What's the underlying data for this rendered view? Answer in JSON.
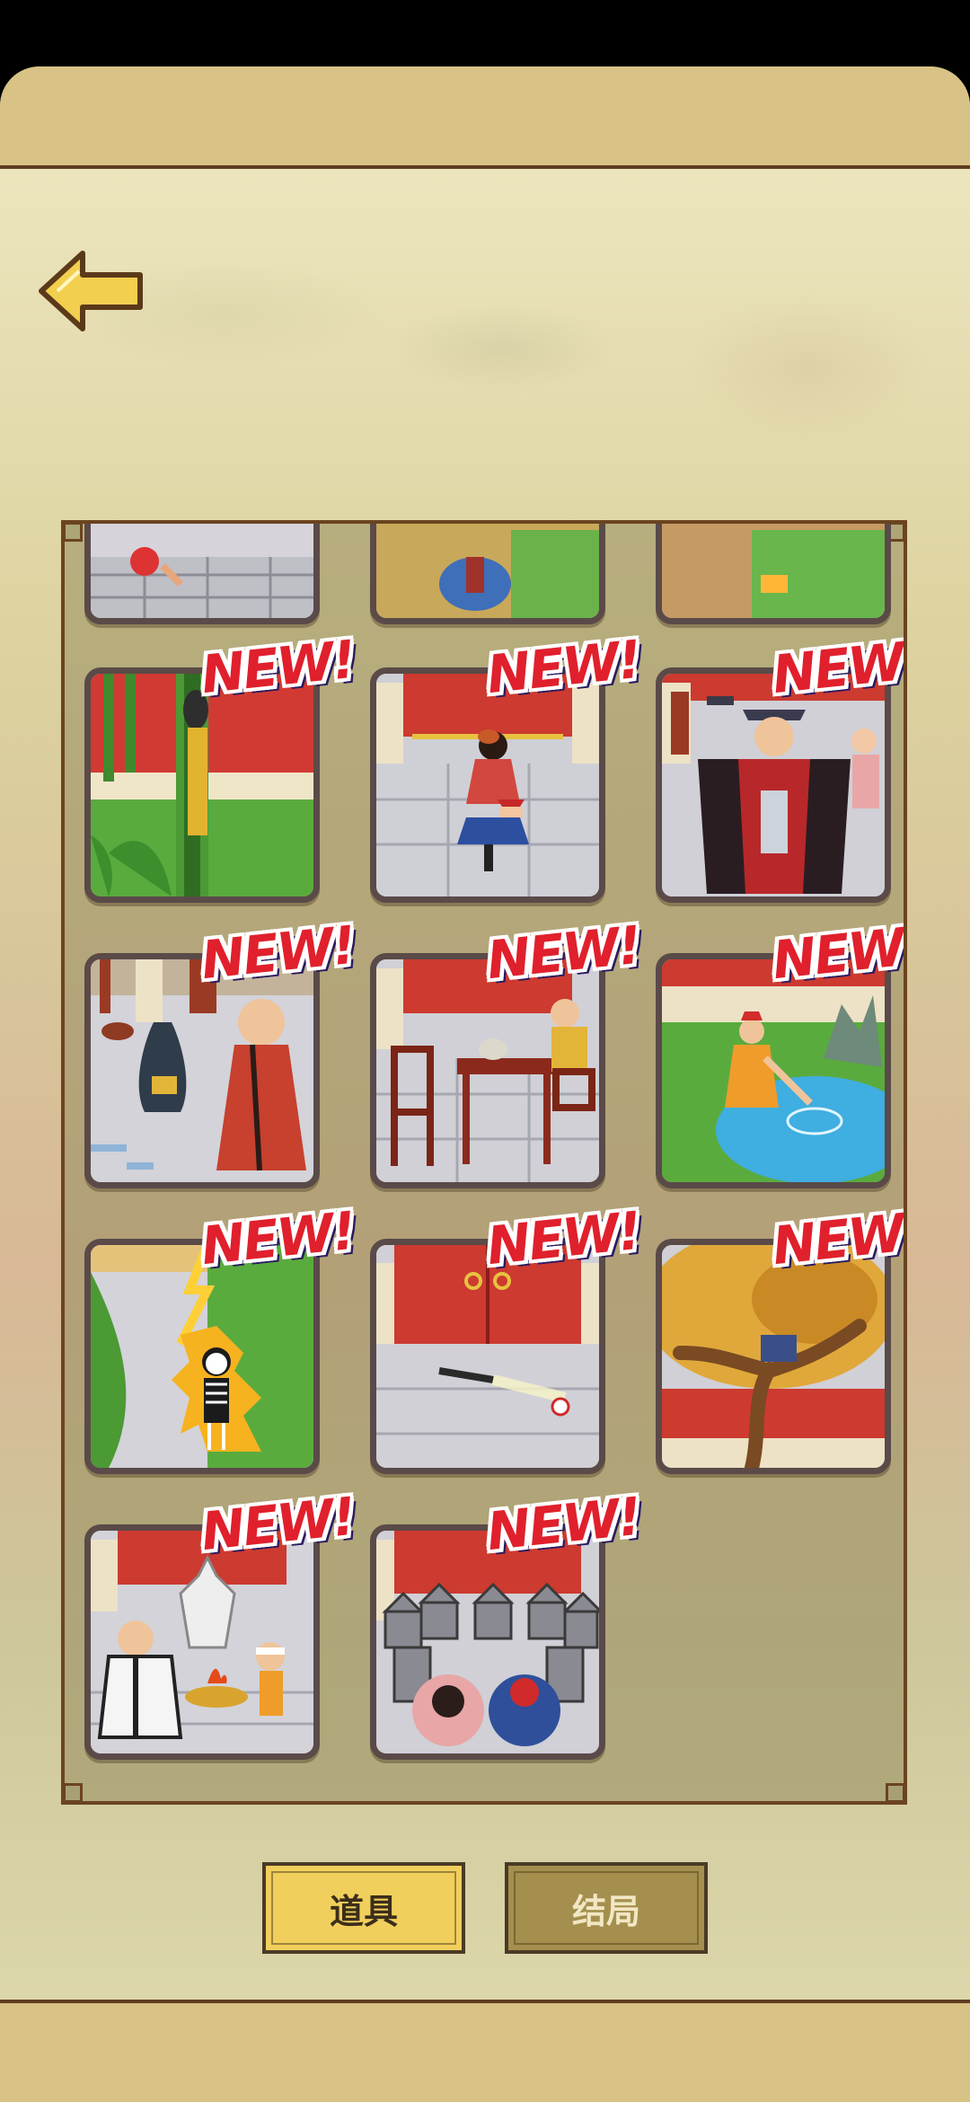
{
  "header": {
    "back_label": "back"
  },
  "gallery": {
    "badge_text": "NEW!",
    "cards": [
      {
        "id": "partial-1",
        "new": false
      },
      {
        "id": "partial-2",
        "new": false
      },
      {
        "id": "partial-3",
        "new": false
      },
      {
        "id": "tree-hanging",
        "new": true
      },
      {
        "id": "empress-official",
        "new": true
      },
      {
        "id": "official-robe",
        "new": true
      },
      {
        "id": "broken-vase",
        "new": true
      },
      {
        "id": "tea-table",
        "new": true
      },
      {
        "id": "pond-fishing",
        "new": true
      },
      {
        "id": "lightning-skeleton",
        "new": true
      },
      {
        "id": "gate-arrow",
        "new": true
      },
      {
        "id": "autumn-tree",
        "new": true
      },
      {
        "id": "brazier-ghost",
        "new": true
      },
      {
        "id": "soldier-crowd",
        "new": true
      }
    ]
  },
  "tabs": {
    "items_label": "道具",
    "endings_label": "结局"
  },
  "colors": {
    "accent": "#f1cf5c",
    "inactive": "#a48f4e",
    "frame": "#6b4420",
    "badge": "#e0202c"
  }
}
